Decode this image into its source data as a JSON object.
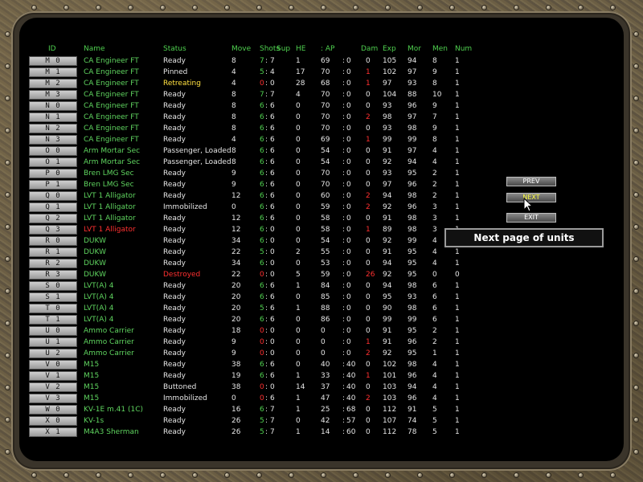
{
  "columns": [
    "ID",
    "Name",
    "Status",
    "Move",
    "Shots",
    "Sup",
    "HE",
    ": AP",
    "Dam",
    "Exp",
    "Mor",
    "Men",
    "Num"
  ],
  "rows": [
    {
      "id": "M 0",
      "name": "CA Engineer FT",
      "status": "Ready",
      "move": "8",
      "sa": "7",
      "sb": "7",
      "sup": "1",
      "he": "69",
      "ap": "0",
      "dam": "0",
      "exp": "105",
      "mor": "94",
      "men": "8",
      "num": "1"
    },
    {
      "id": "M 1",
      "name": "CA Engineer FT",
      "status": "Pinned",
      "move": "4",
      "sa": "5",
      "sb": "4",
      "sup": "17",
      "he": "70",
      "ap": "0",
      "dam": "1",
      "exp": "102",
      "mor": "97",
      "men": "9",
      "num": "1"
    },
    {
      "id": "M 2",
      "name": "CA Engineer FT",
      "status": "Retreating",
      "move": "4",
      "sa": "0",
      "sb": "0",
      "sup": "28",
      "he": "68",
      "ap": "0",
      "dam": "1",
      "exp": "97",
      "mor": "93",
      "men": "8",
      "num": "1"
    },
    {
      "id": "M 3",
      "name": "CA Engineer FT",
      "status": "Ready",
      "move": "8",
      "sa": "7",
      "sb": "7",
      "sup": "4",
      "he": "70",
      "ap": "0",
      "dam": "0",
      "exp": "104",
      "mor": "88",
      "men": "10",
      "num": "1"
    },
    {
      "id": "N 0",
      "name": "CA Engineer FT",
      "status": "Ready",
      "move": "8",
      "sa": "6",
      "sb": "6",
      "sup": "0",
      "he": "70",
      "ap": "0",
      "dam": "0",
      "exp": "93",
      "mor": "96",
      "men": "9",
      "num": "1"
    },
    {
      "id": "N 1",
      "name": "CA Engineer FT",
      "status": "Ready",
      "move": "8",
      "sa": "6",
      "sb": "6",
      "sup": "0",
      "he": "70",
      "ap": "0",
      "dam": "2",
      "exp": "98",
      "mor": "97",
      "men": "7",
      "num": "1"
    },
    {
      "id": "N 2",
      "name": "CA Engineer FT",
      "status": "Ready",
      "move": "8",
      "sa": "6",
      "sb": "6",
      "sup": "0",
      "he": "70",
      "ap": "0",
      "dam": "0",
      "exp": "93",
      "mor": "98",
      "men": "9",
      "num": "1"
    },
    {
      "id": "N 3",
      "name": "CA Engineer FT",
      "status": "Ready",
      "move": "4",
      "sa": "6",
      "sb": "6",
      "sup": "0",
      "he": "69",
      "ap": "0",
      "dam": "1",
      "exp": "99",
      "mor": "99",
      "men": "8",
      "num": "1"
    },
    {
      "id": "O 0",
      "name": "Arm Mortar Sec",
      "status": "Passenger,  Loaded",
      "move": "8",
      "sa": "6",
      "sb": "6",
      "sup": "0",
      "he": "54",
      "ap": "0",
      "dam": "0",
      "exp": "91",
      "mor": "97",
      "men": "4",
      "num": "1"
    },
    {
      "id": "O 1",
      "name": "Arm Mortar Sec",
      "status": "Passenger,  Loaded",
      "move": "8",
      "sa": "6",
      "sb": "6",
      "sup": "0",
      "he": "54",
      "ap": "0",
      "dam": "0",
      "exp": "92",
      "mor": "94",
      "men": "4",
      "num": "1"
    },
    {
      "id": "P 0",
      "name": "Bren LMG Sec",
      "status": "Ready",
      "move": "9",
      "sa": "6",
      "sb": "6",
      "sup": "0",
      "he": "70",
      "ap": "0",
      "dam": "0",
      "exp": "93",
      "mor": "95",
      "men": "2",
      "num": "1"
    },
    {
      "id": "P 1",
      "name": "Bren LMG Sec",
      "status": "Ready",
      "move": "9",
      "sa": "6",
      "sb": "6",
      "sup": "0",
      "he": "70",
      "ap": "0",
      "dam": "0",
      "exp": "97",
      "mor": "96",
      "men": "2",
      "num": "1"
    },
    {
      "id": "Q 0",
      "name": "LVT 1 Alligator",
      "status": "Ready",
      "move": "12",
      "sa": "6",
      "sb": "6",
      "sup": "0",
      "he": "60",
      "ap": "0",
      "dam": "2",
      "exp": "94",
      "mor": "98",
      "men": "2",
      "num": "1"
    },
    {
      "id": "Q 1",
      "name": "LVT 1 Alligator",
      "status": "Immobilized",
      "move": "0",
      "sa": "6",
      "sb": "6",
      "sup": "0",
      "he": "59",
      "ap": "0",
      "dam": "2",
      "exp": "92",
      "mor": "96",
      "men": "3",
      "num": "1"
    },
    {
      "id": "Q 2",
      "name": "LVT 1 Alligator",
      "status": "Ready",
      "move": "12",
      "sa": "6",
      "sb": "6",
      "sup": "0",
      "he": "58",
      "ap": "0",
      "dam": "0",
      "exp": "91",
      "mor": "98",
      "men": "3",
      "num": "1"
    },
    {
      "id": "Q 3",
      "name": "LVT 1 Alligator",
      "status": "Ready",
      "move": "12",
      "sa": "6",
      "sb": "0",
      "sup": "0",
      "he": "58",
      "ap": "0",
      "dam": "1",
      "exp": "89",
      "mor": "98",
      "men": "3",
      "num": "1",
      "red": true
    },
    {
      "id": "R 0",
      "name": "DUKW",
      "status": "Ready",
      "move": "34",
      "sa": "6",
      "sb": "0",
      "sup": "0",
      "he": "54",
      "ap": "0",
      "dam": "0",
      "exp": "92",
      "mor": "99",
      "men": "4",
      "num": "1"
    },
    {
      "id": "R 1",
      "name": "DUKW",
      "status": "Ready",
      "move": "22",
      "sa": "5",
      "sb": "0",
      "sup": "2",
      "he": "55",
      "ap": "0",
      "dam": "0",
      "exp": "91",
      "mor": "95",
      "men": "4",
      "num": "1"
    },
    {
      "id": "R 2",
      "name": "DUKW",
      "status": "Ready",
      "move": "34",
      "sa": "6",
      "sb": "0",
      "sup": "0",
      "he": "53",
      "ap": "0",
      "dam": "0",
      "exp": "94",
      "mor": "95",
      "men": "4",
      "num": "1"
    },
    {
      "id": "R 3",
      "name": "DUKW",
      "status": "Destroyed",
      "move": "22",
      "sa": "0",
      "sb": "0",
      "sup": "5",
      "he": "59",
      "ap": "0",
      "dam": "26",
      "exp": "92",
      "mor": "95",
      "men": "0",
      "num": "0"
    },
    {
      "id": "S 0",
      "name": "LVT(A) 4",
      "status": "Ready",
      "move": "20",
      "sa": "6",
      "sb": "6",
      "sup": "1",
      "he": "84",
      "ap": "0",
      "dam": "0",
      "exp": "94",
      "mor": "98",
      "men": "6",
      "num": "1"
    },
    {
      "id": "S 1",
      "name": "LVT(A) 4",
      "status": "Ready",
      "move": "20",
      "sa": "6",
      "sb": "6",
      "sup": "0",
      "he": "85",
      "ap": "0",
      "dam": "0",
      "exp": "95",
      "mor": "93",
      "men": "6",
      "num": "1"
    },
    {
      "id": "T 0",
      "name": "LVT(A) 4",
      "status": "Ready",
      "move": "20",
      "sa": "5",
      "sb": "6",
      "sup": "1",
      "he": "88",
      "ap": "0",
      "dam": "0",
      "exp": "90",
      "mor": "98",
      "men": "6",
      "num": "1"
    },
    {
      "id": "T 1",
      "name": "LVT(A) 4",
      "status": "Ready",
      "move": "20",
      "sa": "6",
      "sb": "6",
      "sup": "0",
      "he": "86",
      "ap": "0",
      "dam": "0",
      "exp": "99",
      "mor": "99",
      "men": "6",
      "num": "1"
    },
    {
      "id": "U 0",
      "name": "Ammo Carrier",
      "status": "Ready",
      "move": "18",
      "sa": "0",
      "sb": "0",
      "sup": "0",
      "he": "0",
      "ap": "0",
      "dam": "0",
      "exp": "91",
      "mor": "95",
      "men": "2",
      "num": "1"
    },
    {
      "id": "U 1",
      "name": "Ammo Carrier",
      "status": "Ready",
      "move": "9",
      "sa": "0",
      "sb": "0",
      "sup": "0",
      "he": "0",
      "ap": "0",
      "dam": "1",
      "exp": "91",
      "mor": "96",
      "men": "2",
      "num": "1"
    },
    {
      "id": "U 2",
      "name": "Ammo Carrier",
      "status": "Ready",
      "move": "9",
      "sa": "0",
      "sb": "0",
      "sup": "0",
      "he": "0",
      "ap": "0",
      "dam": "2",
      "exp": "92",
      "mor": "95",
      "men": "1",
      "num": "1"
    },
    {
      "id": "V 0",
      "name": "M15",
      "status": "Ready",
      "move": "38",
      "sa": "6",
      "sb": "6",
      "sup": "0",
      "he": "40",
      "ap": "40",
      "dam": "0",
      "exp": "102",
      "mor": "98",
      "men": "4",
      "num": "1"
    },
    {
      "id": "V 1",
      "name": "M15",
      "status": "Ready",
      "move": "19",
      "sa": "6",
      "sb": "6",
      "sup": "1",
      "he": "33",
      "ap": "40",
      "dam": "1",
      "exp": "101",
      "mor": "96",
      "men": "4",
      "num": "1"
    },
    {
      "id": "V 2",
      "name": "M15",
      "status": "Buttoned",
      "move": "38",
      "sa": "0",
      "sb": "0",
      "sup": "14",
      "he": "37",
      "ap": "40",
      "dam": "0",
      "exp": "103",
      "mor": "94",
      "men": "4",
      "num": "1"
    },
    {
      "id": "V 3",
      "name": "M15",
      "status": "Immobilized",
      "move": "0",
      "sa": "0",
      "sb": "6",
      "sup": "1",
      "he": "47",
      "ap": "40",
      "dam": "2",
      "exp": "103",
      "mor": "96",
      "men": "4",
      "num": "1"
    },
    {
      "id": "W 0",
      "name": "KV-1E m.41 (1C)",
      "status": "Ready",
      "move": "16",
      "sa": "6",
      "sb": "7",
      "sup": "1",
      "he": "25",
      "ap": "68",
      "dam": "0",
      "exp": "112",
      "mor": "91",
      "men": "5",
      "num": "1"
    },
    {
      "id": "X 0",
      "name": "KV-1s",
      "status": "Ready",
      "move": "26",
      "sa": "5",
      "sb": "7",
      "sup": "0",
      "he": "42",
      "ap": "57",
      "dam": "0",
      "exp": "107",
      "mor": "74",
      "men": "5",
      "num": "1"
    },
    {
      "id": "X 1",
      "name": "M4A3 Sherman",
      "status": "Ready",
      "move": "26",
      "sa": "5",
      "sb": "7",
      "sup": "1",
      "he": "14",
      "ap": "60",
      "dam": "0",
      "exp": "112",
      "mor": "78",
      "men": "5",
      "num": "1"
    }
  ],
  "buttons": {
    "prev": "PREV",
    "next": "NEXT",
    "exit": "EXIT"
  },
  "tooltip": "Next page of units",
  "colors": {
    "header": "#4fd04f",
    "name": "#5fd45f",
    "alert": "#ff3030",
    "warn": "#ffe040",
    "text": "#e6e6e6"
  }
}
